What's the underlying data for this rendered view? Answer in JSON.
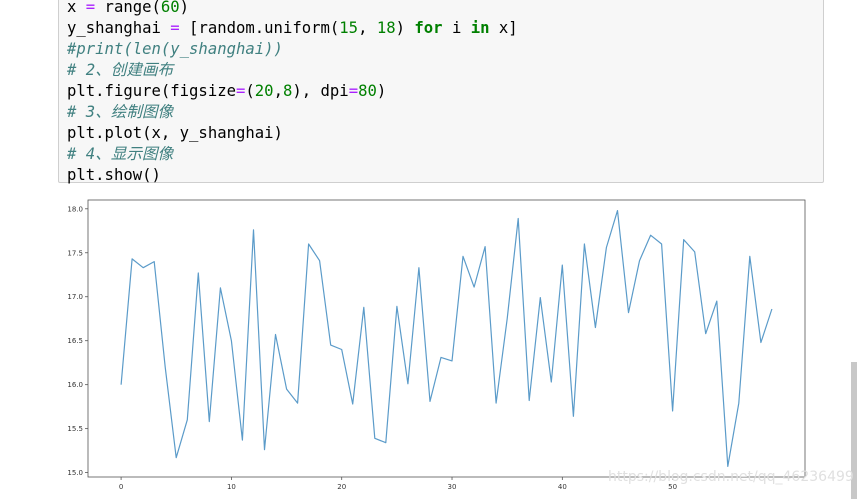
{
  "code": {
    "lines": [
      [
        {
          "t": "x ",
          "c": ""
        },
        {
          "t": "=",
          "c": "op"
        },
        {
          "t": " range(",
          "c": ""
        },
        {
          "t": "60",
          "c": "num"
        },
        {
          "t": ")",
          "c": ""
        }
      ],
      [
        {
          "t": "y_shanghai ",
          "c": ""
        },
        {
          "t": "=",
          "c": "op"
        },
        {
          "t": " [random.uniform(",
          "c": ""
        },
        {
          "t": "15",
          "c": "num"
        },
        {
          "t": ", ",
          "c": ""
        },
        {
          "t": "18",
          "c": "num"
        },
        {
          "t": ") ",
          "c": ""
        },
        {
          "t": "for",
          "c": "kw"
        },
        {
          "t": " i ",
          "c": ""
        },
        {
          "t": "in",
          "c": "kw"
        },
        {
          "t": " x]",
          "c": ""
        }
      ],
      [
        {
          "t": "#print(len(y_shanghai))",
          "c": "cm"
        }
      ],
      [
        {
          "t": "# 2、创建画布",
          "c": "cm"
        }
      ],
      [
        {
          "t": "plt.figure(figsize",
          "c": ""
        },
        {
          "t": "=",
          "c": "op"
        },
        {
          "t": "(",
          "c": ""
        },
        {
          "t": "20",
          "c": "num"
        },
        {
          "t": ",",
          "c": ""
        },
        {
          "t": "8",
          "c": "num"
        },
        {
          "t": "), dpi",
          "c": ""
        },
        {
          "t": "=",
          "c": "op"
        },
        {
          "t": "80",
          "c": "num"
        },
        {
          "t": ")",
          "c": ""
        }
      ],
      [
        {
          "t": "# 3、绘制图像",
          "c": "cm"
        }
      ],
      [
        {
          "t": "plt.plot(x, y_shanghai)",
          "c": ""
        }
      ],
      [
        {
          "t": "# 4、显示图像",
          "c": "cm"
        }
      ],
      [
        {
          "t": "plt.show()",
          "c": ""
        }
      ]
    ]
  },
  "watermark": "https://blog.csdn.net/qq_46236499",
  "colors": {
    "line": "#5b9bc9",
    "cell_bg": "#f7f7f7",
    "keyword": "#008000",
    "comment": "#408080",
    "operator": "#aa22ff"
  },
  "chart_data": {
    "type": "line",
    "x": [
      0,
      1,
      2,
      3,
      4,
      5,
      6,
      7,
      8,
      9,
      10,
      11,
      12,
      13,
      14,
      15,
      16,
      17,
      18,
      19,
      20,
      21,
      22,
      23,
      24,
      25,
      26,
      27,
      28,
      29,
      30,
      31,
      32,
      33,
      34,
      35,
      36,
      37,
      38,
      39,
      40,
      41,
      42,
      43,
      44,
      45,
      46,
      47,
      48,
      49,
      50,
      51,
      52,
      53,
      54,
      55,
      56,
      57,
      58,
      59
    ],
    "y": [
      16.0,
      17.43,
      17.33,
      17.4,
      16.2,
      15.17,
      15.6,
      17.27,
      15.58,
      17.1,
      16.5,
      15.37,
      17.76,
      15.26,
      16.57,
      15.95,
      15.79,
      17.6,
      17.41,
      16.45,
      16.4,
      15.78,
      16.88,
      15.39,
      15.34,
      16.89,
      16.01,
      17.33,
      15.81,
      16.31,
      16.27,
      17.46,
      17.11,
      17.57,
      15.79,
      16.75,
      17.89,
      15.82,
      16.99,
      16.03,
      17.36,
      15.64,
      17.6,
      16.65,
      17.56,
      17.98,
      16.82,
      17.41,
      17.7,
      17.6,
      15.7,
      17.65,
      17.51,
      16.58,
      16.95,
      15.07,
      15.79,
      17.46,
      16.48,
      16.86
    ],
    "xlim": [
      -3,
      62
    ],
    "ylim": [
      14.95,
      18.1
    ],
    "xticks": [
      0,
      10,
      20,
      30,
      40,
      50
    ],
    "yticks": [
      15.0,
      15.5,
      16.0,
      16.5,
      17.0,
      17.5,
      18.0
    ],
    "grid": false
  }
}
